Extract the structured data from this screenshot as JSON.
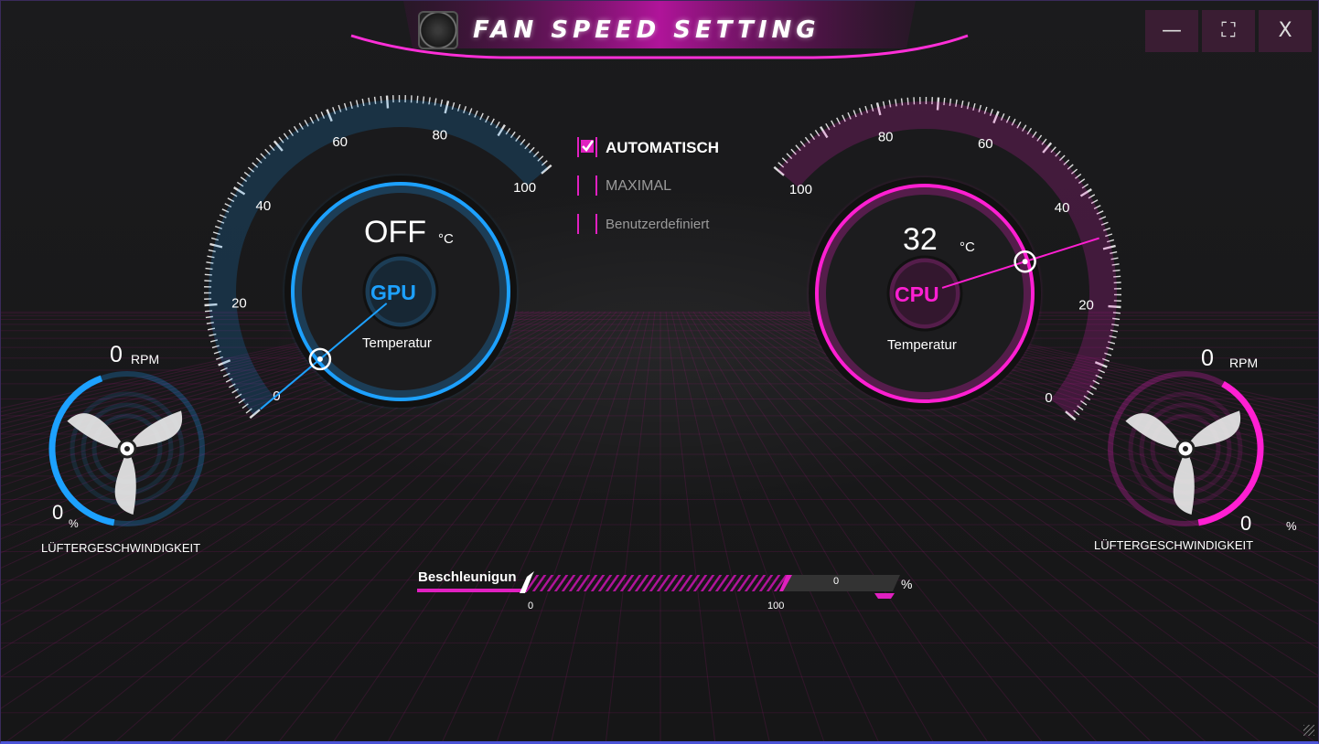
{
  "window": {
    "title": "FAN SPEED SETTING",
    "buttons": {
      "minimize": "—",
      "maximize": "⛶",
      "close": "X"
    }
  },
  "colors": {
    "gpu": "#1da1ff",
    "cpu": "#ff1fd2",
    "accent": "#e020c0",
    "background": "#1a1a1c"
  },
  "gpu": {
    "label": "GPU",
    "temperature": "OFF",
    "unit": "°C",
    "temp_label": "Temperatur",
    "needle_value": 0,
    "scale": [
      "0",
      "20",
      "40",
      "60",
      "80",
      "100"
    ],
    "fan": {
      "rpm_value": "0",
      "rpm_unit": "RPM",
      "percent_value": "0",
      "percent_unit": "%",
      "label": "LÜFTERGESCHWINDIGKEIT",
      "level": 0.0
    }
  },
  "cpu": {
    "label": "CPU",
    "temperature": "32",
    "unit": "°C",
    "temp_label": "Temperatur",
    "needle_value": 32,
    "scale": [
      "0",
      "20",
      "40",
      "60",
      "80",
      "100"
    ],
    "fan": {
      "rpm_value": "0",
      "rpm_unit": "RPM",
      "percent_value": "0",
      "percent_unit": "%",
      "label": "LÜFTERGESCHWINDIGKEIT",
      "level": 0.0
    }
  },
  "modes": [
    {
      "label": "AUTOMATISCH",
      "checked": true
    },
    {
      "label": "MAXIMAL",
      "checked": false
    },
    {
      "label": "Benutzerdefiniert",
      "checked": false
    }
  ],
  "acceleration": {
    "label": "Beschleunigun",
    "value": "0",
    "unit": "%",
    "min_label": "0",
    "max_label": "100"
  }
}
